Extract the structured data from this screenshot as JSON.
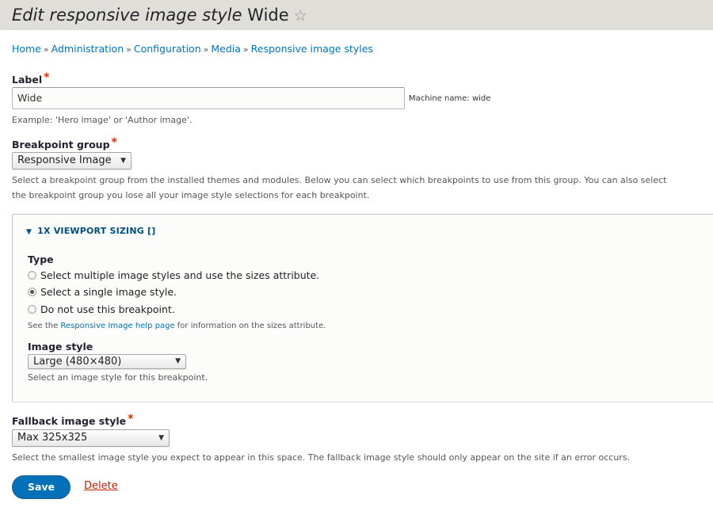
{
  "header": {
    "title_prefix": "Edit responsive image style",
    "title_name": "Wide",
    "star_icon": "☆"
  },
  "breadcrumb": {
    "items": [
      "Home",
      "Administration",
      "Configuration",
      "Media",
      "Responsive image styles"
    ],
    "separator": "»"
  },
  "label_field": {
    "label": "Label",
    "required_marker": "*",
    "value": "Wide",
    "machine_name": "Machine name: wide",
    "description": "Example: 'Hero image' or 'Author image'."
  },
  "breakpoint_group": {
    "label": "Breakpoint group",
    "required_marker": "*",
    "selected": "Responsive Image",
    "arrow": "▼",
    "description_line1": "Select a breakpoint group from the installed themes and modules. Below you can select which breakpoints to use from this group. You can also select",
    "description_line2": "the breakpoint group you lose all your image style selections for each breakpoint."
  },
  "viewport_sizing": {
    "summary_icon": "▼",
    "summary": "1X VIEWPORT SIZING []",
    "type_label": "Type",
    "options": [
      {
        "label": "Select multiple image styles and use the sizes attribute.",
        "checked": false
      },
      {
        "label": "Select a single image style.",
        "checked": true
      },
      {
        "label": "Do not use this breakpoint.",
        "checked": false
      }
    ],
    "help_prefix": "See the ",
    "help_link": "Responsive Image help page",
    "help_suffix": " for information on the sizes attribute.",
    "image_style_label": "Image style",
    "image_style_selected": "Large (480×480)",
    "image_style_description": "Select an image style for this breakpoint."
  },
  "fallback": {
    "label": "Fallback image style",
    "required_marker": "*",
    "selected": "Max 325x325",
    "description": "Select the smallest image style you expect to appear in this space. The fallback image style should only appear on the site if an error occurs."
  },
  "actions": {
    "save": "Save",
    "delete": "Delete"
  },
  "colors": {
    "link": "#0074bd",
    "primary_button": "#0071b8",
    "danger_link": "#c72100",
    "required": "#e62600",
    "header_bg": "#e0ded8"
  }
}
